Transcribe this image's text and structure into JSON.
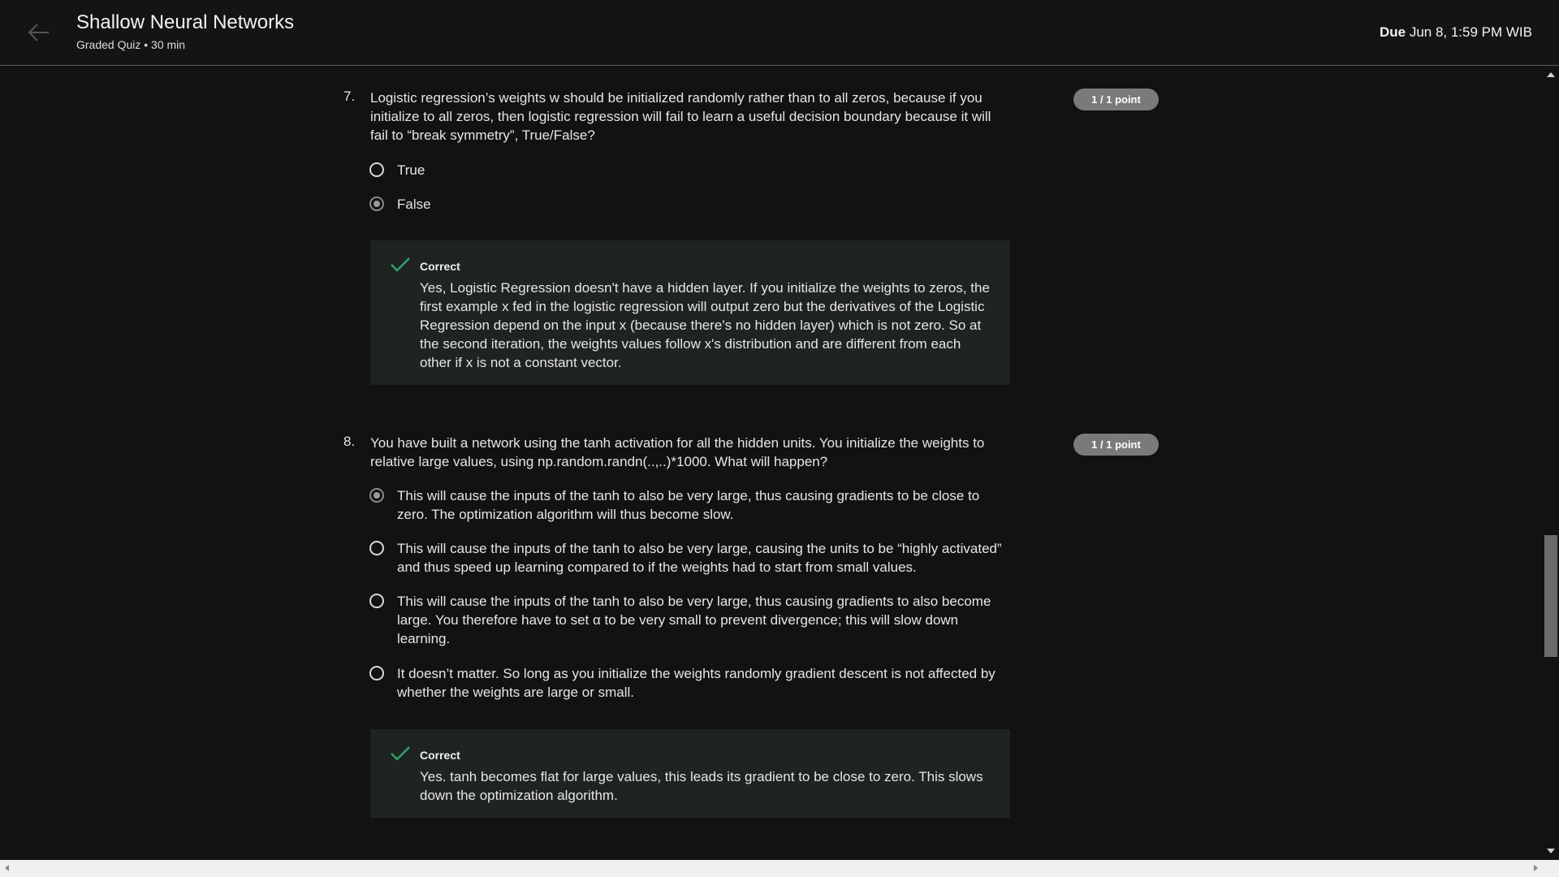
{
  "header": {
    "title": "Shallow Neural Networks",
    "subtitle": "Graded Quiz • 30 min",
    "due_label": "Due",
    "due_value": "Jun 8, 1:59 PM WIB"
  },
  "questions": [
    {
      "number": "7.",
      "text": "Logistic regression’s weights w should be initialized randomly rather than to all zeros, because if you initialize to all zeros, then logistic regression will fail to learn a useful decision boundary because it will fail to “break symmetry”, True/False?",
      "points": "1 / 1 point",
      "options": [
        {
          "label": "True",
          "selected": false
        },
        {
          "label": "False",
          "selected": true
        }
      ],
      "feedback": {
        "title": "Correct",
        "text": "Yes, Logistic Regression doesn't have a hidden layer. If you initialize the weights to zeros, the first example x fed in the logistic regression will output zero but the derivatives of the Logistic Regression depend on the input x (because there's no hidden layer) which is not zero. So at the second iteration, the weights values follow x's distribution and are different from each other if x is not a constant vector."
      }
    },
    {
      "number": "8.",
      "text": "You have built a network using the tanh activation for all the hidden units. You initialize the weights to relative large values, using np.random.randn(..,..)*1000. What will happen?",
      "points": "1 / 1 point",
      "options": [
        {
          "label": "This will cause the inputs of the tanh to also be very large, thus causing gradients to be close to zero. The optimization algorithm will thus become slow.",
          "selected": true
        },
        {
          "label": "This will cause the inputs of the tanh to also be very large, causing the units to be “highly activated” and thus speed up learning compared to if the weights had to start from small values.",
          "selected": false
        },
        {
          "label": "This will cause the inputs of the tanh to also be very large, thus causing gradients to also become large. You therefore have to set α to be very small to prevent divergence; this will slow down learning.",
          "selected": false
        },
        {
          "label": "It doesn’t matter. So long as you initialize the weights randomly gradient descent is not affected by whether the weights are large or small.",
          "selected": false
        }
      ],
      "feedback": {
        "title": "Correct",
        "text": "Yes. tanh becomes flat for large values, this leads its gradient to be close to zero. This slows down the optimization algorithm."
      }
    }
  ],
  "icons": {
    "back": "arrow-left-icon",
    "check": "check-icon"
  },
  "colors": {
    "background": "#121212",
    "feedback_bg": "#1f2322",
    "check_green": "#2fa36b",
    "badge": "#7a7a7a"
  }
}
